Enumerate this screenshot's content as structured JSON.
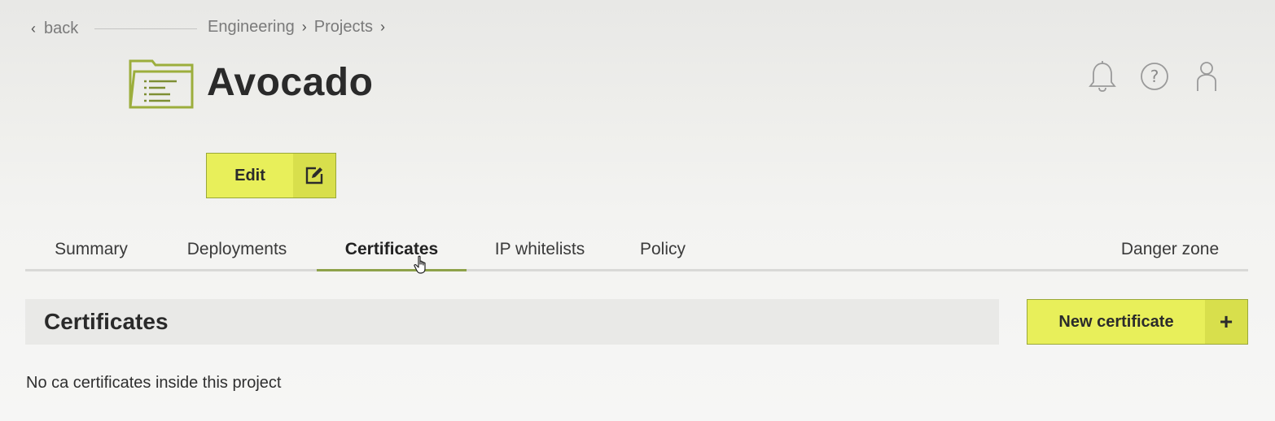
{
  "nav": {
    "back_label": "back",
    "breadcrumb": [
      "Engineering",
      "Projects"
    ]
  },
  "header": {
    "title": "Avocado",
    "icon": "folder-list-icon",
    "actions": [
      "bell-icon",
      "help-icon",
      "user-icon"
    ]
  },
  "edit_button": {
    "label": "Edit",
    "icon": "edit-icon"
  },
  "tabs": [
    {
      "label": "Summary"
    },
    {
      "label": "Deployments"
    },
    {
      "label": "Certificates",
      "active": true
    },
    {
      "label": "IP whitelists"
    },
    {
      "label": "Policy"
    },
    {
      "label": "Danger zone"
    }
  ],
  "certificates": {
    "title": "Certificates",
    "new_button": {
      "label": "New certificate",
      "icon": "plus-icon"
    },
    "empty_message": "No ca certificates inside this project"
  },
  "colors": {
    "accent_button": "#e8ef5a",
    "accent_button_dark": "#d8df4c",
    "active_tab_underline": "#8ea24a",
    "folder_icon": "#9cae3c"
  }
}
